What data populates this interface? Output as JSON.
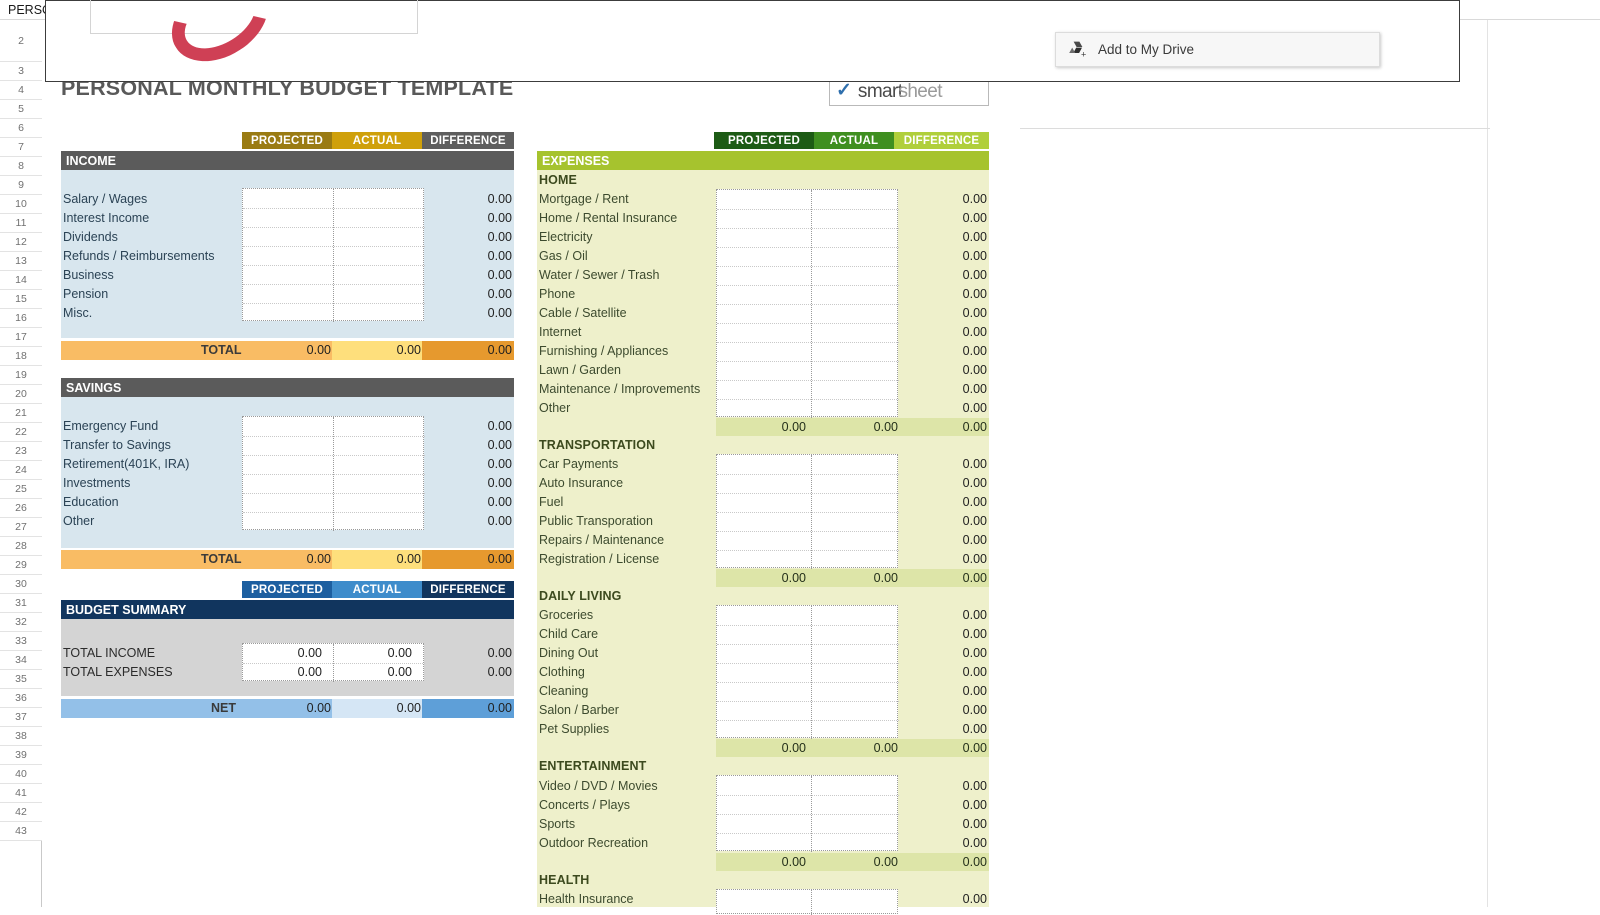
{
  "window": {
    "doc_title": "PERSONAL MONTHLY BUDGET TEMPLATE",
    "title_separator": ":",
    "doc_subtitle": "Personal Monthly Budget Template"
  },
  "overlay": {
    "add_to_drive_label": "Add to My Drive",
    "drive_icon": "google-drive-add-icon"
  },
  "sheet": {
    "title": "PERSONAL MONTHLY BUDGET TEMPLATE",
    "logo": {
      "check": "✓",
      "word1": "smart",
      "word2": "sheet"
    },
    "row_numbers": [
      2,
      3,
      4,
      5,
      6,
      7,
      8,
      9,
      10,
      11,
      12,
      13,
      14,
      15,
      16,
      17,
      18,
      19,
      20,
      21,
      22,
      23,
      24,
      25,
      26,
      27,
      28,
      29,
      30,
      31,
      32,
      33,
      34,
      35,
      36,
      37,
      38,
      39,
      40,
      41,
      42,
      43
    ]
  },
  "colors": {
    "income_projected": "#9a7b13",
    "income_actual": "#cfa00b",
    "income_difference": "#5e5e5e",
    "income_section_bar": "#5b5b5b",
    "income_body_bg": "#d8e6ee",
    "total_projected": "#f9bc64",
    "total_actual": "#fedf7c",
    "total_difference": "#e6992e",
    "summary_projected": "#1d5fa0",
    "summary_actual": "#3e8ccb",
    "summary_difference": "#11355e",
    "summary_bar": "#11355e",
    "summary_body_bg": "#d4d4d4",
    "net_projected": "#93c0e8",
    "net_actual": "#d5e6f5",
    "net_difference": "#5e9fd8",
    "expenses_projected": "#1d5b15",
    "expenses_actual": "#3f8f20",
    "expenses_difference": "#b0cf3b",
    "expenses_section_bar": "#a6c32e",
    "expenses_body_bg": "#eef0cb",
    "expenses_subtotal": "#dde5a8"
  },
  "headers": {
    "projected": "PROJECTED",
    "actual": "ACTUAL",
    "difference": "DIFFERENCE"
  },
  "income": {
    "section_title": "INCOME",
    "items": [
      {
        "label": "Salary / Wages",
        "difference": "0.00"
      },
      {
        "label": "Interest Income",
        "difference": "0.00"
      },
      {
        "label": "Dividends",
        "difference": "0.00"
      },
      {
        "label": "Refunds / Reimbursements",
        "difference": "0.00"
      },
      {
        "label": "Business",
        "difference": "0.00"
      },
      {
        "label": "Pension",
        "difference": "0.00"
      },
      {
        "label": "Misc.",
        "difference": "0.00"
      }
    ],
    "total": {
      "label": "TOTAL",
      "projected": "0.00",
      "actual": "0.00",
      "difference": "0.00"
    }
  },
  "savings": {
    "section_title": "SAVINGS",
    "items": [
      {
        "label": "Emergency Fund",
        "difference": "0.00"
      },
      {
        "label": "Transfer to Savings",
        "difference": "0.00"
      },
      {
        "label": "Retirement(401K, IRA)",
        "difference": "0.00"
      },
      {
        "label": "Investments",
        "difference": "0.00"
      },
      {
        "label": "Education",
        "difference": "0.00"
      },
      {
        "label": "Other",
        "difference": "0.00"
      }
    ],
    "total": {
      "label": "TOTAL",
      "projected": "0.00",
      "actual": "0.00",
      "difference": "0.00"
    }
  },
  "budget_summary": {
    "section_title": "BUDGET SUMMARY",
    "rows": [
      {
        "label": "TOTAL INCOME",
        "projected": "0.00",
        "actual": "0.00",
        "difference": "0.00"
      },
      {
        "label": "TOTAL EXPENSES",
        "projected": "0.00",
        "actual": "0.00",
        "difference": "0.00"
      }
    ],
    "net": {
      "label": "NET",
      "projected": "0.00",
      "actual": "0.00",
      "difference": "0.00"
    }
  },
  "expenses": {
    "section_title": "EXPENSES",
    "categories": [
      {
        "name": "HOME",
        "items": [
          {
            "label": "Mortgage / Rent",
            "difference": "0.00"
          },
          {
            "label": "Home / Rental Insurance",
            "difference": "0.00"
          },
          {
            "label": "Electricity",
            "difference": "0.00"
          },
          {
            "label": "Gas / Oil",
            "difference": "0.00"
          },
          {
            "label": "Water / Sewer / Trash",
            "difference": "0.00"
          },
          {
            "label": "Phone",
            "difference": "0.00"
          },
          {
            "label": "Cable / Satellite",
            "difference": "0.00"
          },
          {
            "label": "Internet",
            "difference": "0.00"
          },
          {
            "label": "Furnishing / Appliances",
            "difference": "0.00"
          },
          {
            "label": "Lawn / Garden",
            "difference": "0.00"
          },
          {
            "label": "Maintenance / Improvements",
            "difference": "0.00"
          },
          {
            "label": "Other",
            "difference": "0.00"
          }
        ],
        "subtotal": {
          "projected": "0.00",
          "actual": "0.00",
          "difference": "0.00"
        }
      },
      {
        "name": "TRANSPORTATION",
        "items": [
          {
            "label": "Car Payments",
            "difference": "0.00"
          },
          {
            "label": "Auto Insurance",
            "difference": "0.00"
          },
          {
            "label": "Fuel",
            "difference": "0.00"
          },
          {
            "label": "Public Transporation",
            "difference": "0.00"
          },
          {
            "label": "Repairs / Maintenance",
            "difference": "0.00"
          },
          {
            "label": "Registration / License",
            "difference": "0.00"
          }
        ],
        "subtotal": {
          "projected": "0.00",
          "actual": "0.00",
          "difference": "0.00"
        }
      },
      {
        "name": "DAILY LIVING",
        "items": [
          {
            "label": "Groceries",
            "difference": "0.00"
          },
          {
            "label": "Child Care",
            "difference": "0.00"
          },
          {
            "label": "Dining Out",
            "difference": "0.00"
          },
          {
            "label": "Clothing",
            "difference": "0.00"
          },
          {
            "label": "Cleaning",
            "difference": "0.00"
          },
          {
            "label": "Salon / Barber",
            "difference": "0.00"
          },
          {
            "label": "Pet Supplies",
            "difference": "0.00"
          }
        ],
        "subtotal": {
          "projected": "0.00",
          "actual": "0.00",
          "difference": "0.00"
        }
      },
      {
        "name": "ENTERTAINMENT",
        "items": [
          {
            "label": "Video / DVD / Movies",
            "difference": "0.00"
          },
          {
            "label": "Concerts / Plays",
            "difference": "0.00"
          },
          {
            "label": "Sports",
            "difference": "0.00"
          },
          {
            "label": "Outdoor Recreation",
            "difference": "0.00"
          }
        ],
        "subtotal": {
          "projected": "0.00",
          "actual": "0.00",
          "difference": "0.00"
        }
      },
      {
        "name": "HEALTH",
        "items": [
          {
            "label": "Health Insurance",
            "difference": "0.00"
          }
        ],
        "subtotal": null
      }
    ]
  }
}
